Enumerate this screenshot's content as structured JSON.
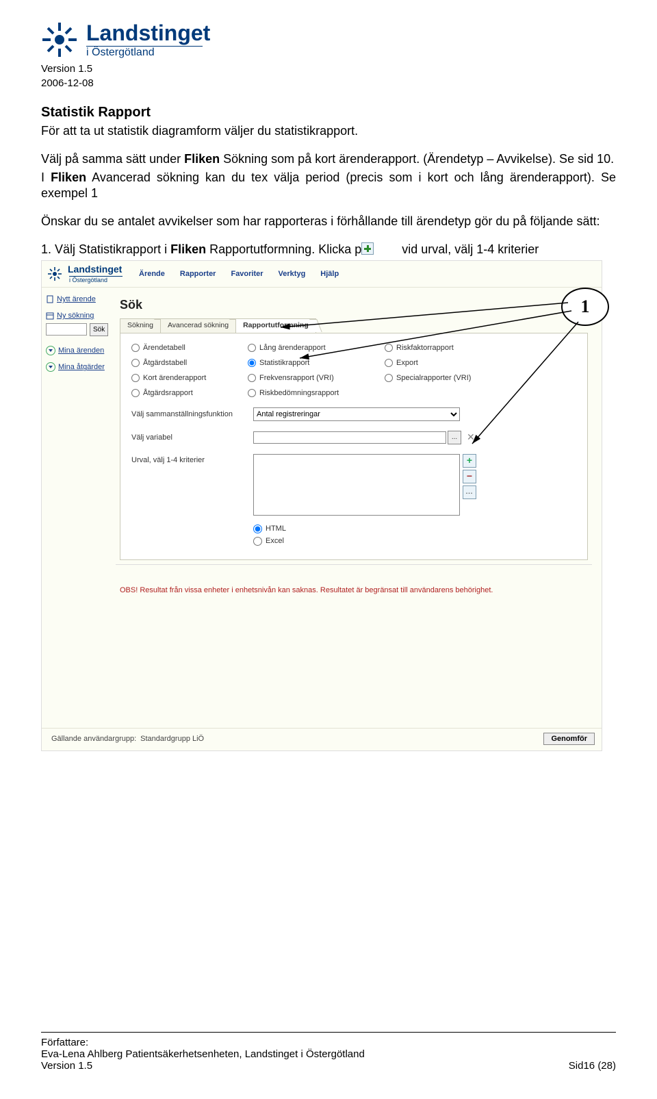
{
  "header": {
    "brand_title": "Landstinget",
    "brand_sub": "i Östergötland",
    "version": "Version 1.5",
    "date": "2006-12-08"
  },
  "doc": {
    "h_statistik": "Statistik Rapport",
    "p1": "För att ta ut statistik diagramform väljer du statistikrapport.",
    "p2a": "Välj på samma sätt under ",
    "p2b": "Fliken",
    "p2c": " Sökning som på kort ärenderapport. (Ärendetyp – Avvikelse). Se sid 10.",
    "p3a": "I ",
    "p3b": "Fliken",
    "p3c": " Avancerad sökning kan du tex välja period (precis som i kort och lång ärenderapport). Se exempel 1",
    "p4": "Önskar du se antalet avvikelser som har rapporteras i förhållande till ärendetyp gör du på följande sätt:",
    "p5a": "1. Välj Statistikrapport i ",
    "p5b": "Fliken",
    "p5c": " Rapportutformning. Klicka p",
    "p5d": " vid urval, välj 1-4 kriterier"
  },
  "shot": {
    "brand_title": "Landstinget",
    "brand_sub": "i Östergötland",
    "menu": [
      "Ärende",
      "Rapporter",
      "Favoriter",
      "Verktyg",
      "Hjälp"
    ],
    "side": {
      "nytt": "Nytt ärende",
      "ny_sok": "Ny sökning",
      "sok_btn": "Sök",
      "mina_ar": "Mina ärenden",
      "mina_at": "Mina åtgärder"
    },
    "sok_title": "Sök",
    "tabs": [
      "Sökning",
      "Avancerad sökning",
      "Rapportutformning"
    ],
    "opts": {
      "c1": [
        "Ärendetabell",
        "Åtgärdstabell",
        "Kort ärenderapport",
        "Åtgärdsrapport"
      ],
      "c2": [
        "Lång ärenderapport",
        "Statistikrapport",
        "Frekvensrapport (VRI)",
        "Riskbedömningsrapport"
      ],
      "c3": [
        "Riskfaktorrapport",
        "Export",
        "Specialrapporter (VRI)"
      ]
    },
    "lbl_samman": "Välj sammanställningsfunktion",
    "sel_samman": "Antal registreringar",
    "lbl_variabel": "Välj variabel",
    "lbl_urval": "Urval, välj 1-4 kriterier",
    "fmt": [
      "HTML",
      "Excel"
    ],
    "warn": "OBS! Resultat från vissa enheter i enhetsnivån kan saknas. Resultatet är begränsat till användarens behörighet.",
    "bottom_lbl": "Gällande användargrupp:",
    "bottom_val": "Standardgrupp LiÖ",
    "genom": "Genomför"
  },
  "annot": {
    "one": "1"
  },
  "footer": {
    "author_lbl": "Författare:",
    "author": "Eva-Lena Ahlberg Patientsäkerhetsenheten, Landstinget i Östergötland",
    "ver": "Version 1.5",
    "page": "Sid16 (28)"
  }
}
